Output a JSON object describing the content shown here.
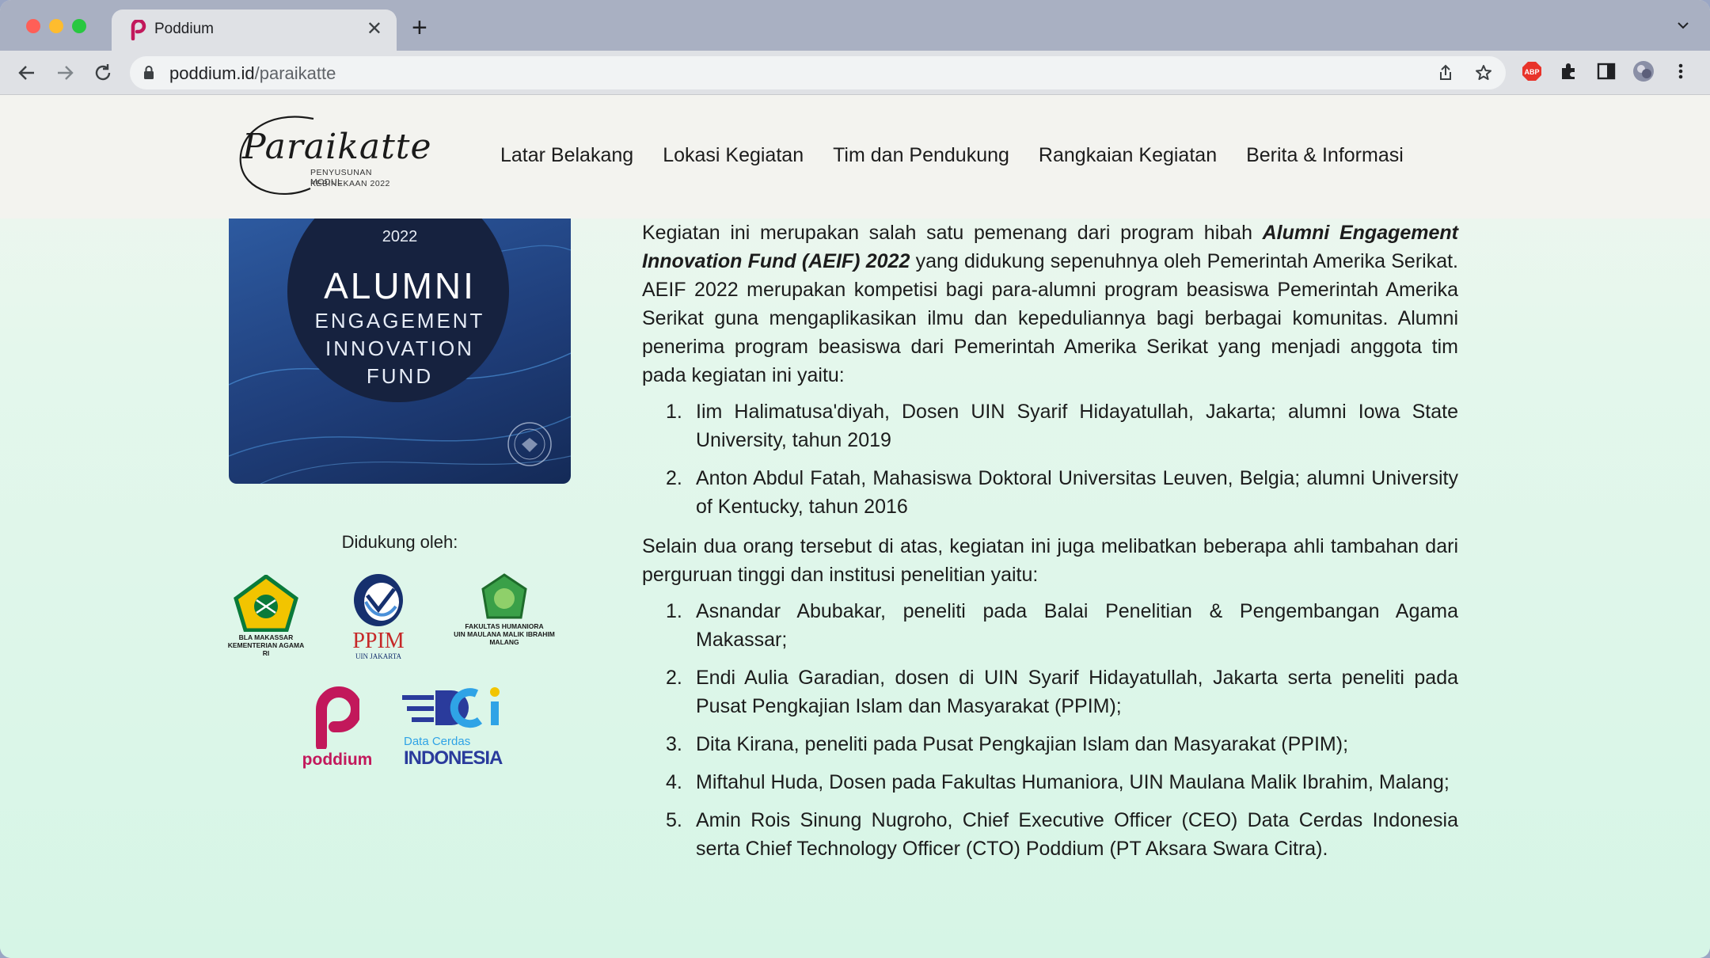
{
  "browser": {
    "tab_title": "Poddium",
    "url_host": "poddium.id",
    "url_path": "/paraikatte",
    "abp_label": "ABP"
  },
  "site": {
    "logo_script": "Paraikatte",
    "logo_sub1": "PENYUSUNAN MODUL",
    "logo_sub2": "KEBINEKAAN 2022",
    "nav": [
      "Latar Belakang",
      "Lokasi Kegiatan",
      "Tim dan Pendukung",
      "Rangkaian Kegiatan",
      "Berita & Informasi"
    ]
  },
  "aeif": {
    "year": "2022",
    "line1": "ALUMNI",
    "line2": "ENGAGEMENT",
    "line3": "INNOVATION",
    "line4": "FUND"
  },
  "sponsors": {
    "heading": "Didukung oleh:",
    "bla_caption_1": "BLA MAKASSAR",
    "bla_caption_2": "KEMENTERIAN AGAMA RI",
    "ppim_label": "PPIM",
    "ppim_sub": "UIN JAKARTA",
    "fh_caption_1": "FAKULTAS HUMANIORA",
    "fh_caption_2": "UIN MAULANA MALIK IBRAHIM",
    "fh_caption_3": "MALANG",
    "poddium_label": "poddium",
    "dci_line1": "Data Cerdas",
    "dci_line2": "INDONESIA"
  },
  "content": {
    "p1_before": "Kegiatan ini merupakan salah satu pemenang dari program hibah ",
    "p1_em": "Alumni Engagement Innovation Fund (AEIF) 2022",
    "p1_after": " yang didukung sepenuhnya oleh Pemerintah Amerika Serikat. AEIF 2022 merupakan kompetisi bagi para-alumni program beasiswa Pemerintah Amerika Serikat guna mengaplikasikan ilmu dan kepeduliannya bagi berbagai komunitas. Alumni penerima program beasiswa dari Pemerintah Amerika Serikat yang menjadi anggota tim pada kegiatan ini yaitu:",
    "list1": [
      {
        "num": "1.",
        "text": "Iim Halimatusa'diyah, Dosen UIN Syarif Hidayatullah, Jakarta; alumni Iowa State University, tahun 2019"
      },
      {
        "num": "2.",
        "text": "Anton Abdul Fatah, Mahasiswa Doktoral Universitas Leuven, Belgia; alumni University of Kentucky, tahun 2016"
      }
    ],
    "p2": "Selain dua orang tersebut di atas, kegiatan ini juga melibatkan beberapa ahli tambahan dari perguruan tinggi dan institusi penelitian yaitu:",
    "list2": [
      {
        "num": "1.",
        "text": "Asnandar Abubakar, peneliti pada Balai Penelitian & Pengembangan Agama Makassar;"
      },
      {
        "num": "2.",
        "text": "Endi Aulia Garadian, dosen di UIN Syarif Hidayatullah, Jakarta serta peneliti pada Pusat Pengkajian Islam dan Masyarakat (PPIM);"
      },
      {
        "num": "3.",
        "text": "Dita Kirana, peneliti pada Pusat Pengkajian Islam dan Masyarakat (PPIM);"
      },
      {
        "num": "4.",
        "text": "Miftahul Huda, Dosen pada Fakultas Humaniora, UIN Maulana Malik Ibrahim, Malang;"
      },
      {
        "num": "5.",
        "text": "Amin Rois Sinung Nugroho, Chief Executive Officer (CEO) Data Cerdas Indonesia serta Chief Technology Officer (CTO) Poddium (PT Aksara Swara Citra)."
      }
    ]
  }
}
